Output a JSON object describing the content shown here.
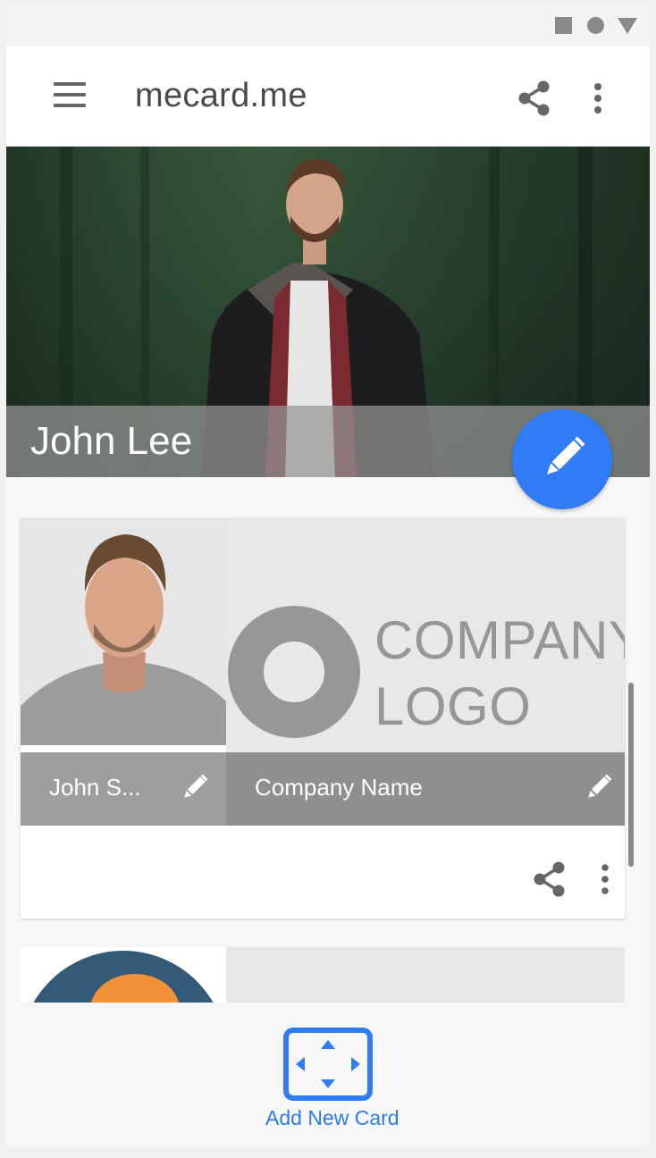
{
  "app": {
    "title": "mecard.me"
  },
  "profile": {
    "name": "John Lee"
  },
  "card": {
    "person_name": "John S...",
    "company_name": "Company Name",
    "logo_line1": "COMPANY",
    "logo_line2": "LOGO"
  },
  "bottom": {
    "add_label": "Add New Card"
  },
  "colors": {
    "accent": "#2f7cf6",
    "link": "#2b7ce9",
    "bar_gray": "#9e9e9e",
    "icon_gray": "#666666"
  },
  "icons": {
    "menu": "hamburger-icon",
    "share": "share-icon",
    "more": "more-vert-icon",
    "edit": "pencil-icon",
    "add": "add-card-icon"
  }
}
